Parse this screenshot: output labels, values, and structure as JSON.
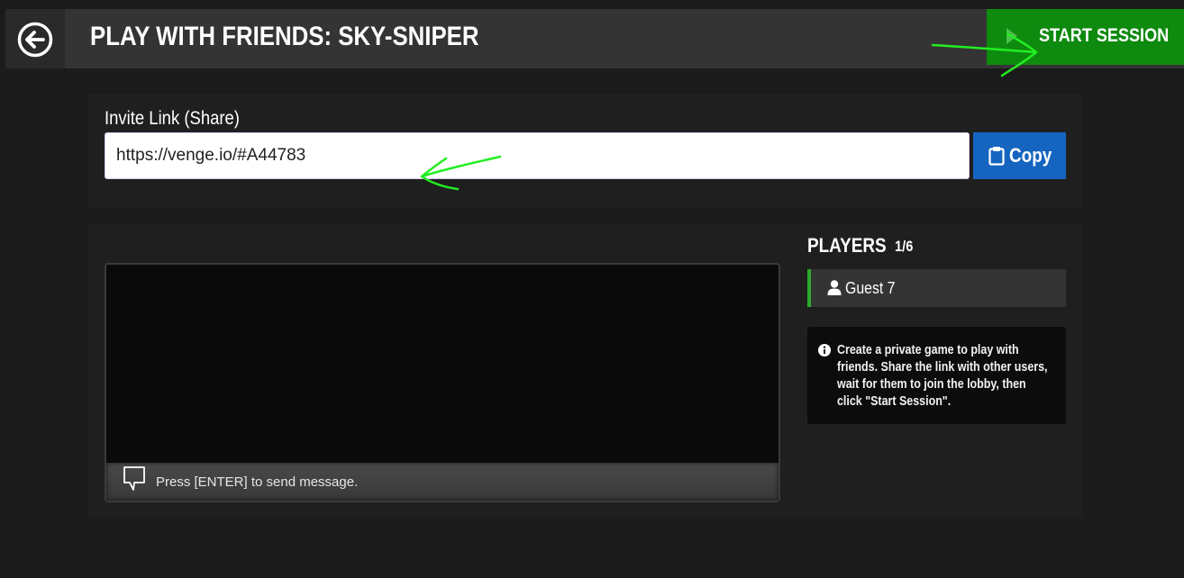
{
  "header": {
    "title": "PLAY WITH FRIENDS: SKY-SNIPER",
    "start_label": "START SESSION"
  },
  "invite": {
    "label": "Invite Link (Share)",
    "value": "https://venge.io/#A44783",
    "copy_label": "Copy"
  },
  "chat": {
    "placeholder": "Press [ENTER] to send message."
  },
  "players": {
    "title": "PLAYERS",
    "count": "1/6",
    "list": [
      {
        "name": "Guest 7"
      }
    ]
  },
  "info": {
    "text": "Create a private game to play with friends. Share the link with other users, wait for them to join the lobby, then click \"Start Session\"."
  },
  "colors": {
    "start_button": "#0e8a0e",
    "copy_button": "#1565c0",
    "player_accent": "#2ea82e",
    "annotation": "#22ee22"
  },
  "icons": {
    "back": "arrow-left-circle-icon",
    "start": "play-icon",
    "copy": "clipboard-icon",
    "chat": "speech-bubble-icon",
    "player": "user-icon",
    "info": "info-circle-icon"
  }
}
